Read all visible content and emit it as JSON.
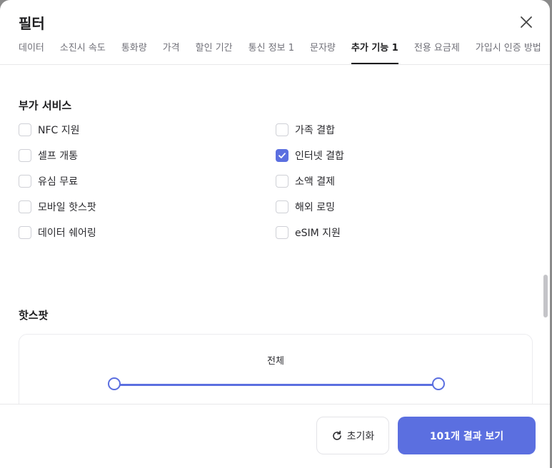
{
  "modal": {
    "title": "필터",
    "close_icon": "close-icon"
  },
  "tabs": [
    {
      "label": "데이터",
      "active": false
    },
    {
      "label": "소진시 속도",
      "active": false
    },
    {
      "label": "통화량",
      "active": false
    },
    {
      "label": "가격",
      "active": false
    },
    {
      "label": "할인 기간",
      "active": false
    },
    {
      "label": "통신 정보 1",
      "active": false
    },
    {
      "label": "문자량",
      "active": false
    },
    {
      "label": "추가 기능 1",
      "active": true
    },
    {
      "label": "전용 요금제",
      "active": false
    },
    {
      "label": "가입시 인증 방법",
      "active": false
    }
  ],
  "services": {
    "title": "부가 서비스",
    "left": [
      {
        "label": "NFC 지원",
        "checked": false
      },
      {
        "label": "셀프 개통",
        "checked": false
      },
      {
        "label": "유심 무료",
        "checked": false
      },
      {
        "label": "모바일 핫스팟",
        "checked": false
      },
      {
        "label": "데이터 쉐어링",
        "checked": false
      }
    ],
    "right": [
      {
        "label": "가족 결합",
        "checked": false
      },
      {
        "label": "인터넷 결합",
        "checked": true
      },
      {
        "label": "소액 결제",
        "checked": false
      },
      {
        "label": "해외 로밍",
        "checked": false
      },
      {
        "label": "eSIM 지원",
        "checked": false
      }
    ]
  },
  "hotspot": {
    "title": "핫스팟",
    "range_label": "전체",
    "range_min_fraction": 0,
    "range_max_fraction": 1
  },
  "footer": {
    "reset_label": "초기화",
    "results_label": "101개 결과 보기"
  },
  "colors": {
    "accent": "#5b6fe0"
  }
}
